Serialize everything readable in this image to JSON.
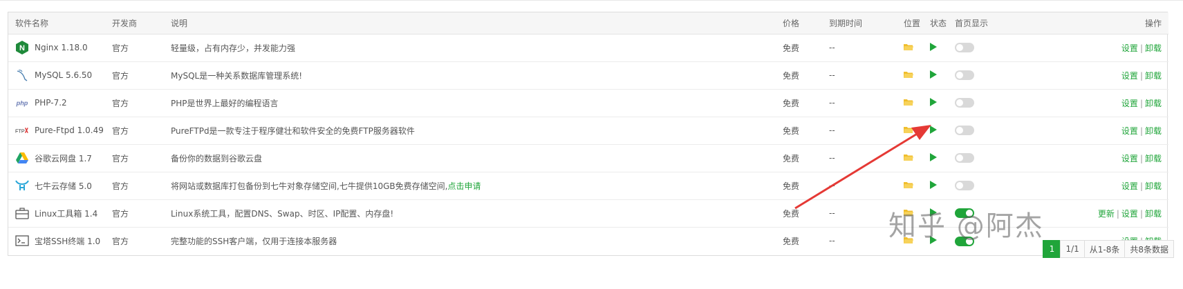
{
  "table": {
    "headers": {
      "name": "软件名称",
      "developer": "开发商",
      "desc": "说明",
      "price": "价格",
      "expire": "到期时间",
      "location": "位置",
      "status": "状态",
      "homepage": "首页显示",
      "ops": "操作"
    },
    "rows": [
      {
        "name": "Nginx 1.18.0",
        "icon": "nginx-icon",
        "developer": "官方",
        "desc": "轻量级，占有内存少，并发能力强",
        "desc_link": "",
        "price": "免费",
        "expire": "--",
        "home_on": false,
        "ops": [
          "设置",
          "卸载"
        ]
      },
      {
        "name": "MySQL 5.6.50",
        "icon": "mysql-icon",
        "developer": "官方",
        "desc": "MySQL是一种关系数据库管理系统!",
        "desc_link": "",
        "price": "免费",
        "expire": "--",
        "home_on": false,
        "ops": [
          "设置",
          "卸载"
        ]
      },
      {
        "name": "PHP-7.2",
        "icon": "php-icon",
        "developer": "官方",
        "desc": "PHP是世界上最好的编程语言",
        "desc_link": "",
        "price": "免费",
        "expire": "--",
        "home_on": false,
        "ops": [
          "设置",
          "卸载"
        ]
      },
      {
        "name": "Pure-Ftpd 1.0.49",
        "icon": "ftp-icon",
        "developer": "官方",
        "desc": "PureFTPd是一款专注于程序健壮和软件安全的免费FTP服务器软件",
        "desc_link": "",
        "price": "免费",
        "expire": "--",
        "home_on": false,
        "ops": [
          "设置",
          "卸载"
        ]
      },
      {
        "name": "谷歌云网盘 1.7",
        "icon": "google-drive-icon",
        "developer": "官方",
        "desc": "备份你的数据到谷歌云盘",
        "desc_link": "",
        "price": "免费",
        "expire": "--",
        "home_on": false,
        "ops": [
          "设置",
          "卸载"
        ]
      },
      {
        "name": "七牛云存储 5.0",
        "icon": "qiniu-icon",
        "developer": "官方",
        "desc": "将网站或数据库打包备份到七牛对象存储空间,七牛提供10GB免费存储空间,",
        "desc_link": "点击申请",
        "price": "免费",
        "expire": "--",
        "home_on": false,
        "ops": [
          "设置",
          "卸载"
        ]
      },
      {
        "name": "Linux工具箱 1.4",
        "icon": "toolbox-icon",
        "developer": "官方",
        "desc": "Linux系统工具，配置DNS、Swap、时区、IP配置、内存盘!",
        "desc_link": "",
        "price": "免费",
        "expire": "--",
        "home_on": true,
        "ops": [
          "更新",
          "设置",
          "卸载"
        ]
      },
      {
        "name": "宝塔SSH终端 1.0",
        "icon": "terminal-icon",
        "developer": "官方",
        "desc": "完整功能的SSH客户端，仅用于连接本服务器",
        "desc_link": "",
        "price": "免费",
        "expire": "--",
        "home_on": true,
        "ops": [
          "设置",
          "卸载"
        ]
      }
    ]
  },
  "pager": {
    "current": "1",
    "pages": "1/1",
    "range": "从1-8条",
    "total": "共8条数据"
  },
  "watermark": "知乎 @阿杰",
  "colors": {
    "accent": "#20a53a",
    "folder": "#f2c12e",
    "arrow": "#e53935"
  }
}
